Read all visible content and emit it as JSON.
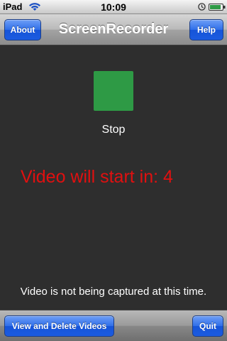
{
  "status_bar": {
    "carrier": "iPad",
    "time": "10:09"
  },
  "nav": {
    "title": "ScreenRecorder",
    "about_label": "About",
    "help_label": "Help"
  },
  "main": {
    "stop_label": "Stop",
    "stop_color": "#2e9a45",
    "countdown_text": "Video will start in: 4",
    "countdown_color": "#e01010",
    "capture_status": "Video is not being captured at this time."
  },
  "toolbar": {
    "view_delete_label": "View and Delete Videos",
    "quit_label": "Quit"
  },
  "icons": [
    "wifi-icon",
    "lock-icon",
    "battery-icon"
  ]
}
